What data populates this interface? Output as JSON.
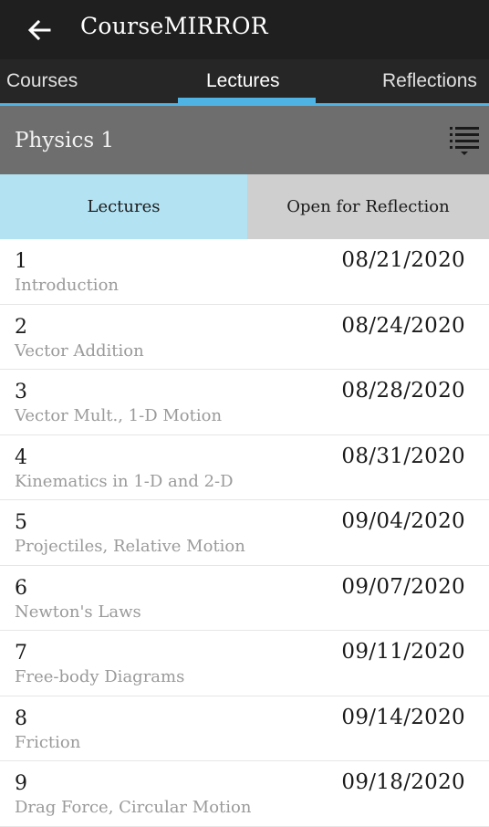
{
  "appbar": {
    "title": "CourseMIRROR",
    "back_icon": "arrow-left-icon"
  },
  "tabs": [
    {
      "label": "Courses"
    },
    {
      "label": "Lectures",
      "active": true
    },
    {
      "label": "Reflections"
    }
  ],
  "course": {
    "title": "Physics 1",
    "menu_icon": "list-filter-icon"
  },
  "segment": {
    "lectures_label": "Lectures",
    "open_label": "Open for Reflection"
  },
  "lectures": [
    {
      "number": "1",
      "date": "08/21/2020",
      "title": "Introduction"
    },
    {
      "number": "2",
      "date": "08/24/2020",
      "title": "Vector Addition"
    },
    {
      "number": "3",
      "date": "08/28/2020",
      "title": "Vector Mult., 1-D Motion"
    },
    {
      "number": "4",
      "date": "08/31/2020",
      "title": "Kinematics in 1-D and 2-D"
    },
    {
      "number": "5",
      "date": "09/04/2020",
      "title": "Projectiles, Relative Motion"
    },
    {
      "number": "6",
      "date": "09/07/2020",
      "title": "Newton's Laws"
    },
    {
      "number": "7",
      "date": "09/11/2020",
      "title": "Free-body Diagrams"
    },
    {
      "number": "8",
      "date": "09/14/2020",
      "title": "Friction"
    },
    {
      "number": "9",
      "date": "09/18/2020",
      "title": "Drag Force, Circular Motion"
    }
  ],
  "colors": {
    "accent": "#4fb3e3",
    "appbar": "#1f1f1f",
    "header": "#6e6e6e",
    "segment_active": "#b3e2f2"
  }
}
